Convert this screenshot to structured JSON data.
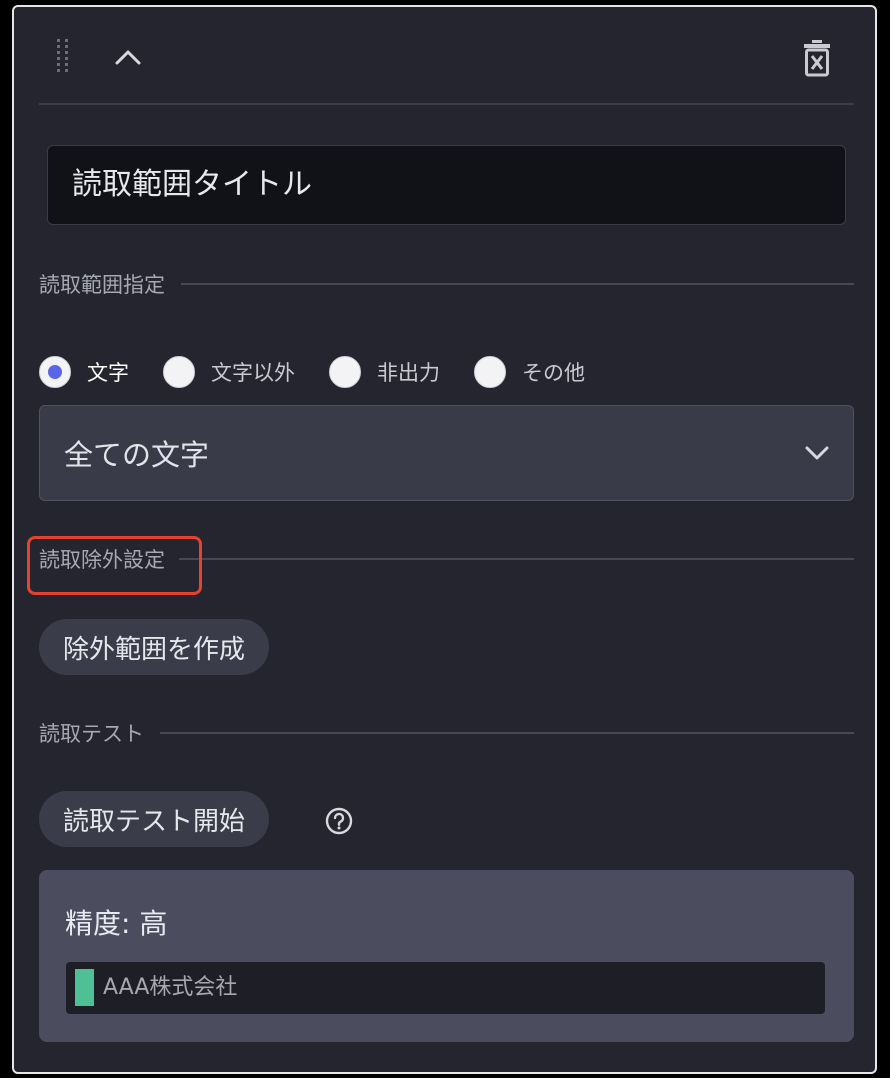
{
  "header": {
    "drag_icon": "drag-handle-icon",
    "collapse_icon": "chevron-up-icon",
    "delete_icon": "trash-icon"
  },
  "title_input": {
    "value": "読取範囲タイトル"
  },
  "read_range": {
    "section_label": "読取範囲指定",
    "radio_options": [
      "文字",
      "文字以外",
      "非出力",
      "その他"
    ],
    "selected": "文字",
    "dropdown_value": "全ての文字",
    "dropdown_icon": "chevron-down-icon"
  },
  "exclusion": {
    "section_label": "読取除外設定",
    "create_button_label": "除外範囲を作成"
  },
  "read_test": {
    "section_label": "読取テスト",
    "start_button_label": "読取テスト開始",
    "help_icon": "question-circle-icon"
  },
  "result": {
    "accuracy_text": "精度: 高",
    "text": "AAA株式会社",
    "marker_color": "#4fbf96"
  },
  "colors": {
    "background": "#24252f",
    "accent_radio": "#5a66e6",
    "highlight": "#e5432d"
  }
}
